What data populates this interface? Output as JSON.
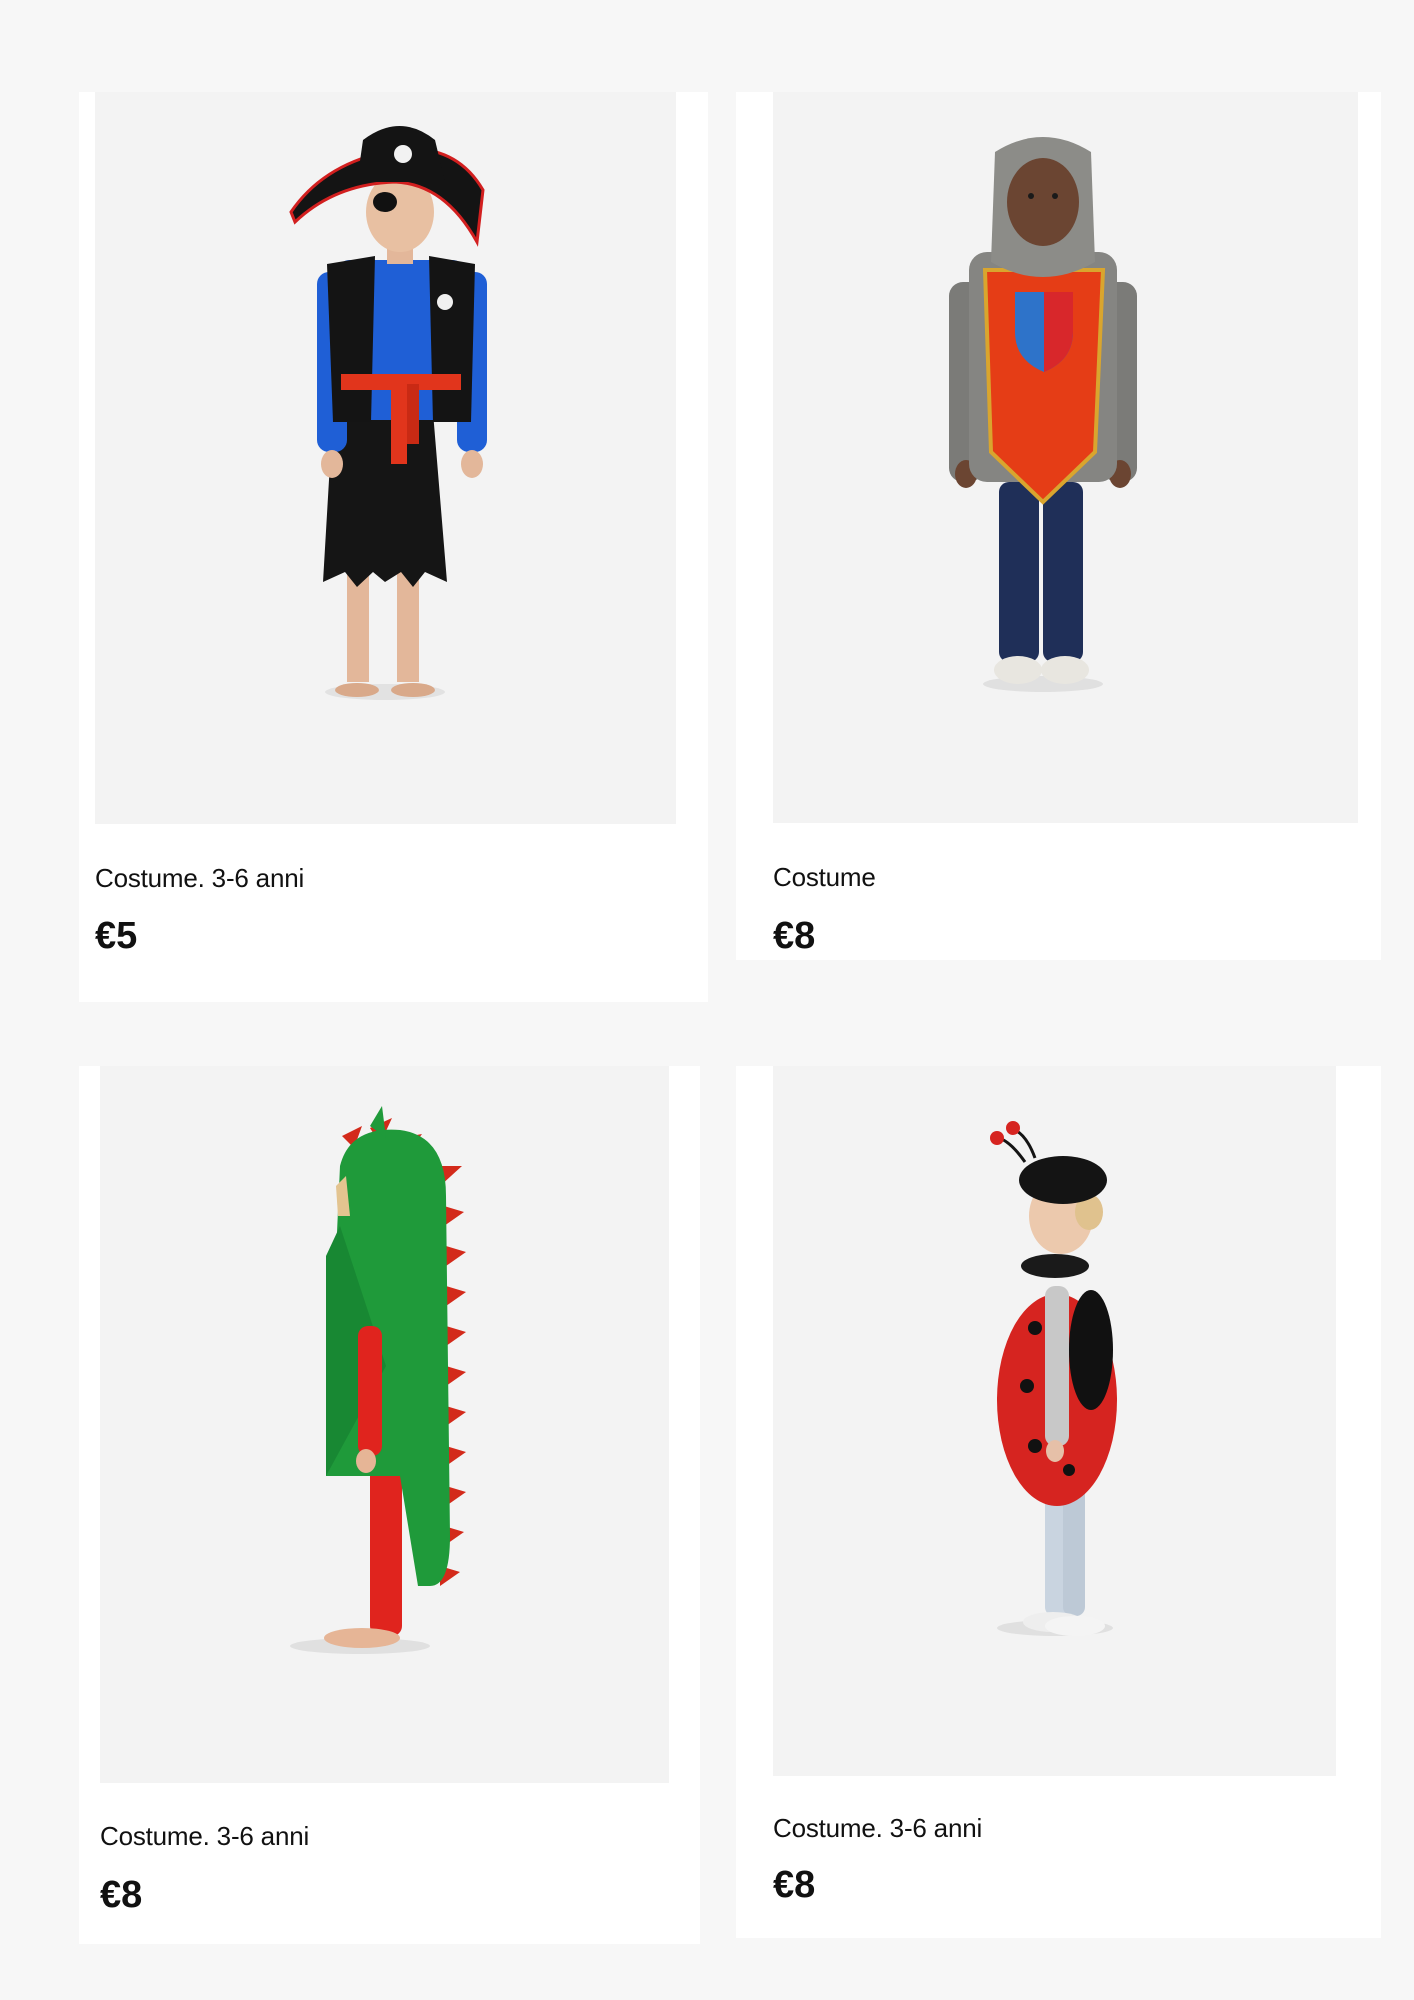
{
  "products": [
    {
      "title": "Costume. 3-6 anni",
      "price": "€5",
      "image_alt": "pirate-costume"
    },
    {
      "title": "Costume",
      "price": "€8",
      "image_alt": "knight-costume"
    },
    {
      "title": "Costume. 3-6 anni",
      "price": "€8",
      "image_alt": "dragon-costume"
    },
    {
      "title": "Costume. 3-6 anni",
      "price": "€8",
      "image_alt": "ladybug-costume"
    }
  ],
  "colors": {
    "page_background": "#f7f7f7",
    "card_background": "#ffffff",
    "photo_background": "#f3f3f3",
    "text": "#111111"
  }
}
